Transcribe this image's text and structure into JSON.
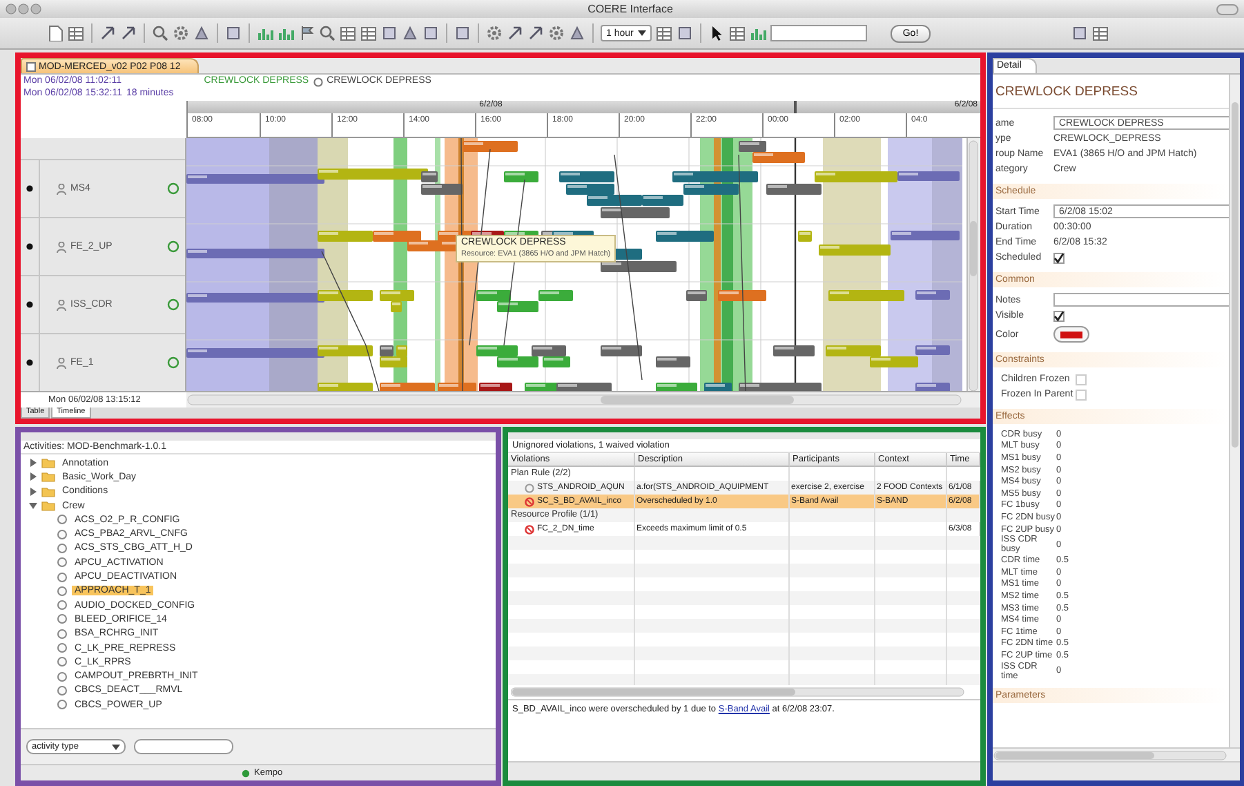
{
  "window": {
    "title": "COERE Interface"
  },
  "toolbar": {
    "time_scale": "1 hour",
    "go_button": "Go!"
  },
  "timeline": {
    "tab": "MOD-MERCED_v02 P02 P08 12",
    "start_time": "Mon 06/02/08 11:02:11",
    "end_time": "Mon 06/02/08 15:32:11",
    "duration": "18 minutes",
    "activity_label": "CREWLOCK DEPRESS",
    "activity_name": "CREWLOCK DEPRESS",
    "dates": [
      "6/2/08",
      "6/2/08"
    ],
    "hours": [
      "08:00",
      "10:00",
      "12:00",
      "14:00",
      "16:00",
      "18:00",
      "20:00",
      "22:00",
      "00:00",
      "02:00",
      "04:0"
    ],
    "rows": [
      {
        "name": "MS4"
      },
      {
        "name": "FE_2_UP"
      },
      {
        "name": "ISS_CDR"
      },
      {
        "name": "FE_1"
      }
    ],
    "tooltip": {
      "title": "CREWLOCK DEPRESS",
      "detail": "Resource: EVA1 (3865 H/O and JPM Hatch)"
    },
    "cursor_time": "Mon 06/02/08 13:15:12",
    "view_tabs": [
      {
        "label": "Table",
        "selected": false
      },
      {
        "label": "Timeline",
        "selected": true
      }
    ]
  },
  "details": {
    "tab": "Detail",
    "title": "CREWLOCK DEPRESS",
    "sections": [
      {
        "items": [
          {
            "kind": "input",
            "label": "ame",
            "value": "CREWLOCK DEPRESS"
          },
          {
            "kind": "text",
            "label": "ype",
            "value": "CREWLOCK_DEPRESS"
          },
          {
            "kind": "text",
            "label": "roup Name",
            "value": "EVA1 (3865 H/O and JPM Hatch)"
          },
          {
            "kind": "text",
            "label": "ategory",
            "value": "Crew"
          }
        ]
      },
      {
        "title": "Schedule",
        "items": [
          {
            "kind": "input",
            "label": "Start Time",
            "value": "6/2/08 15:02"
          },
          {
            "kind": "text",
            "label": "Duration",
            "value": "00:30:00"
          },
          {
            "kind": "text",
            "label": "End Time",
            "value": "6/2/08 15:32"
          },
          {
            "kind": "checkbox",
            "label": "Scheduled",
            "checked": true
          }
        ]
      },
      {
        "title": "Common",
        "items": [
          {
            "kind": "input",
            "label": "Notes"
          },
          {
            "kind": "checkbox",
            "label": "Visible",
            "checked": true
          },
          {
            "kind": "color",
            "label": "Color",
            "color": "#d01010"
          }
        ]
      },
      {
        "title": "Constraints",
        "items": [
          {
            "kind": "checkbox",
            "label": "Children Frozen",
            "checked": false
          },
          {
            "kind": "checkbox",
            "label": "Frozen In Parent",
            "checked": false
          }
        ]
      },
      {
        "title": "Effects",
        "items": [
          {
            "kind": "pair",
            "label": "CDR busy",
            "value": "0"
          },
          {
            "kind": "pair",
            "label": "MLT busy",
            "value": "0"
          },
          {
            "kind": "pair",
            "label": "MS1 busy",
            "value": "0"
          },
          {
            "kind": "pair",
            "label": "MS2 busy",
            "value": "0"
          },
          {
            "kind": "pair",
            "label": "MS4 busy",
            "value": "0"
          },
          {
            "kind": "pair",
            "label": "MS5 busy",
            "value": "0"
          },
          {
            "kind": "pair",
            "label": "FC 1busy",
            "value": "0"
          },
          {
            "kind": "pair",
            "label": "FC 2DN busy",
            "value": "0"
          },
          {
            "kind": "pair",
            "label": "FC 2UP busy",
            "value": "0"
          },
          {
            "kind": "pair",
            "label": "ISS CDR busy",
            "value": "0"
          },
          {
            "kind": "pair",
            "label": "CDR time",
            "value": "0.5"
          },
          {
            "kind": "pair",
            "label": "MLT time",
            "value": "0"
          },
          {
            "kind": "pair",
            "label": "MS1 time",
            "value": "0"
          },
          {
            "kind": "pair",
            "label": "MS2 time",
            "value": "0.5"
          },
          {
            "kind": "pair",
            "label": "MS3 time",
            "value": "0.5"
          },
          {
            "kind": "pair",
            "label": "MS4 time",
            "value": "0"
          },
          {
            "kind": "pair",
            "label": "FC 1time",
            "value": "0"
          },
          {
            "kind": "pair",
            "label": "FC 2DN time",
            "value": "0.5"
          },
          {
            "kind": "pair",
            "label": "FC 2UP time",
            "value": "0.5"
          },
          {
            "kind": "pair",
            "label": "ISS CDR time",
            "value": "0"
          }
        ]
      },
      {
        "title": "Parameters"
      }
    ]
  },
  "activities": {
    "title": "Activities: MOD-Benchmark-1.0.1",
    "items": [
      {
        "kind": "folder",
        "label": "Annotation",
        "expanded": false,
        "selected": false
      },
      {
        "kind": "folder",
        "label": "Basic_Work_Day",
        "expanded": false,
        "selected": false
      },
      {
        "kind": "folder",
        "label": "Conditions",
        "expanded": false,
        "selected": false
      },
      {
        "kind": "folder",
        "label": "Crew",
        "expanded": true,
        "selected": false,
        "children": [
          {
            "kind": "activity",
            "label": "ACS_O2_P_R_CONFIG",
            "selected": false
          },
          {
            "kind": "activity",
            "label": "ACS_PBA2_ARVL_CNFG",
            "selected": false
          },
          {
            "kind": "activity",
            "label": "ACS_STS_CBG_ATT_H_D",
            "selected": false
          },
          {
            "kind": "activity",
            "label": "APCU_ACTIVATION",
            "selected": false
          },
          {
            "kind": "activity",
            "label": "APCU_DEACTIVATION",
            "selected": false
          },
          {
            "kind": "activity",
            "label": "APPROACH_T_1",
            "selected": true
          },
          {
            "kind": "activity",
            "label": "AUDIO_DOCKED_CONFIG",
            "selected": false
          },
          {
            "kind": "activity",
            "label": "BLEED_ORIFICE_14",
            "selected": false
          },
          {
            "kind": "activity",
            "label": "BSA_RCHRG_INIT",
            "selected": false
          },
          {
            "kind": "activity",
            "label": "C_LK_PRE_REPRESS",
            "selected": false
          },
          {
            "kind": "activity",
            "label": "C_LK_RPRS",
            "selected": false
          },
          {
            "kind": "activity",
            "label": "CAMPOUT_PREBRTH_INIT",
            "selected": false
          },
          {
            "kind": "activity",
            "label": "CBCS_DEACT___RMVL",
            "selected": false
          },
          {
            "kind": "activity",
            "label": "CBCS_POWER_UP",
            "selected": false
          }
        ]
      }
    ],
    "filter_type": "activity type",
    "status": "Kempo"
  },
  "violations": {
    "summary": "Unignored violations, 1 waived violation",
    "columns": [
      "Violations",
      "Description",
      "Participants",
      "Context",
      "Time"
    ],
    "groups": [
      {
        "label": "Plan Rule (2/2)",
        "rows": [
          {
            "kind": "waived",
            "selected": false,
            "cells": [
              "STS_ANDROID_AQUN",
              "a.for(STS_ANDROID_AQUIPMENT",
              "exercise 2, exercise",
              "2 FOOD Contexts",
              "6/1/08"
            ]
          },
          {
            "kind": "violation",
            "selected": true,
            "cells": [
              "SC_S_BD_AVAIL_inco",
              "Overscheduled by 1.0",
              "S-Band Avail",
              "S-BAND",
              "6/2/08"
            ]
          }
        ]
      },
      {
        "label": "Resource Profile (1/1)",
        "rows": [
          {
            "kind": "violation",
            "selected": false,
            "cells": [
              "FC_2_DN_time",
              "Exceeds maximum limit of 0.5",
              "",
              "",
              "6/3/08"
            ]
          }
        ]
      }
    ],
    "message": {
      "before": "S_BD_AVAIL_inco were overscheduled by 1 due to ",
      "link": "S-Band Avail",
      "after": " at 6/2/08 23:07."
    }
  }
}
